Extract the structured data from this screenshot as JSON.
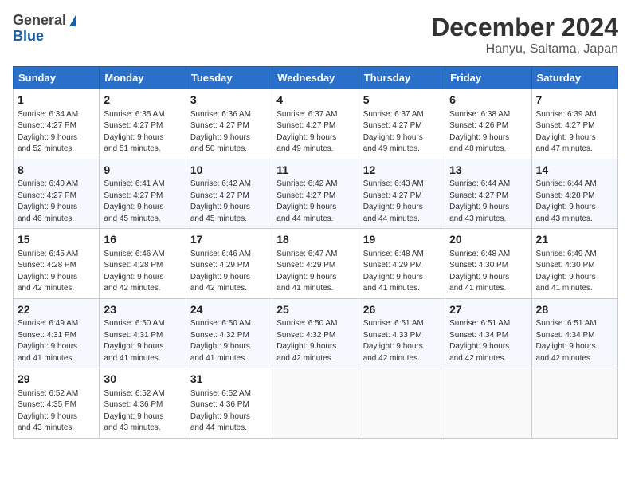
{
  "header": {
    "logo_general": "General",
    "logo_blue": "Blue",
    "title": "December 2024",
    "subtitle": "Hanyu, Saitama, Japan"
  },
  "columns": [
    "Sunday",
    "Monday",
    "Tuesday",
    "Wednesday",
    "Thursday",
    "Friday",
    "Saturday"
  ],
  "weeks": [
    [
      {
        "day": "1",
        "lines": [
          "Sunrise: 6:34 AM",
          "Sunset: 4:27 PM",
          "Daylight: 9 hours",
          "and 52 minutes."
        ]
      },
      {
        "day": "2",
        "lines": [
          "Sunrise: 6:35 AM",
          "Sunset: 4:27 PM",
          "Daylight: 9 hours",
          "and 51 minutes."
        ]
      },
      {
        "day": "3",
        "lines": [
          "Sunrise: 6:36 AM",
          "Sunset: 4:27 PM",
          "Daylight: 9 hours",
          "and 50 minutes."
        ]
      },
      {
        "day": "4",
        "lines": [
          "Sunrise: 6:37 AM",
          "Sunset: 4:27 PM",
          "Daylight: 9 hours",
          "and 49 minutes."
        ]
      },
      {
        "day": "5",
        "lines": [
          "Sunrise: 6:37 AM",
          "Sunset: 4:27 PM",
          "Daylight: 9 hours",
          "and 49 minutes."
        ]
      },
      {
        "day": "6",
        "lines": [
          "Sunrise: 6:38 AM",
          "Sunset: 4:26 PM",
          "Daylight: 9 hours",
          "and 48 minutes."
        ]
      },
      {
        "day": "7",
        "lines": [
          "Sunrise: 6:39 AM",
          "Sunset: 4:27 PM",
          "Daylight: 9 hours",
          "and 47 minutes."
        ]
      }
    ],
    [
      {
        "day": "8",
        "lines": [
          "Sunrise: 6:40 AM",
          "Sunset: 4:27 PM",
          "Daylight: 9 hours",
          "and 46 minutes."
        ]
      },
      {
        "day": "9",
        "lines": [
          "Sunrise: 6:41 AM",
          "Sunset: 4:27 PM",
          "Daylight: 9 hours",
          "and 45 minutes."
        ]
      },
      {
        "day": "10",
        "lines": [
          "Sunrise: 6:42 AM",
          "Sunset: 4:27 PM",
          "Daylight: 9 hours",
          "and 45 minutes."
        ]
      },
      {
        "day": "11",
        "lines": [
          "Sunrise: 6:42 AM",
          "Sunset: 4:27 PM",
          "Daylight: 9 hours",
          "and 44 minutes."
        ]
      },
      {
        "day": "12",
        "lines": [
          "Sunrise: 6:43 AM",
          "Sunset: 4:27 PM",
          "Daylight: 9 hours",
          "and 44 minutes."
        ]
      },
      {
        "day": "13",
        "lines": [
          "Sunrise: 6:44 AM",
          "Sunset: 4:27 PM",
          "Daylight: 9 hours",
          "and 43 minutes."
        ]
      },
      {
        "day": "14",
        "lines": [
          "Sunrise: 6:44 AM",
          "Sunset: 4:28 PM",
          "Daylight: 9 hours",
          "and 43 minutes."
        ]
      }
    ],
    [
      {
        "day": "15",
        "lines": [
          "Sunrise: 6:45 AM",
          "Sunset: 4:28 PM",
          "Daylight: 9 hours",
          "and 42 minutes."
        ]
      },
      {
        "day": "16",
        "lines": [
          "Sunrise: 6:46 AM",
          "Sunset: 4:28 PM",
          "Daylight: 9 hours",
          "and 42 minutes."
        ]
      },
      {
        "day": "17",
        "lines": [
          "Sunrise: 6:46 AM",
          "Sunset: 4:29 PM",
          "Daylight: 9 hours",
          "and 42 minutes."
        ]
      },
      {
        "day": "18",
        "lines": [
          "Sunrise: 6:47 AM",
          "Sunset: 4:29 PM",
          "Daylight: 9 hours",
          "and 41 minutes."
        ]
      },
      {
        "day": "19",
        "lines": [
          "Sunrise: 6:48 AM",
          "Sunset: 4:29 PM",
          "Daylight: 9 hours",
          "and 41 minutes."
        ]
      },
      {
        "day": "20",
        "lines": [
          "Sunrise: 6:48 AM",
          "Sunset: 4:30 PM",
          "Daylight: 9 hours",
          "and 41 minutes."
        ]
      },
      {
        "day": "21",
        "lines": [
          "Sunrise: 6:49 AM",
          "Sunset: 4:30 PM",
          "Daylight: 9 hours",
          "and 41 minutes."
        ]
      }
    ],
    [
      {
        "day": "22",
        "lines": [
          "Sunrise: 6:49 AM",
          "Sunset: 4:31 PM",
          "Daylight: 9 hours",
          "and 41 minutes."
        ]
      },
      {
        "day": "23",
        "lines": [
          "Sunrise: 6:50 AM",
          "Sunset: 4:31 PM",
          "Daylight: 9 hours",
          "and 41 minutes."
        ]
      },
      {
        "day": "24",
        "lines": [
          "Sunrise: 6:50 AM",
          "Sunset: 4:32 PM",
          "Daylight: 9 hours",
          "and 41 minutes."
        ]
      },
      {
        "day": "25",
        "lines": [
          "Sunrise: 6:50 AM",
          "Sunset: 4:32 PM",
          "Daylight: 9 hours",
          "and 42 minutes."
        ]
      },
      {
        "day": "26",
        "lines": [
          "Sunrise: 6:51 AM",
          "Sunset: 4:33 PM",
          "Daylight: 9 hours",
          "and 42 minutes."
        ]
      },
      {
        "day": "27",
        "lines": [
          "Sunrise: 6:51 AM",
          "Sunset: 4:34 PM",
          "Daylight: 9 hours",
          "and 42 minutes."
        ]
      },
      {
        "day": "28",
        "lines": [
          "Sunrise: 6:51 AM",
          "Sunset: 4:34 PM",
          "Daylight: 9 hours",
          "and 42 minutes."
        ]
      }
    ],
    [
      {
        "day": "29",
        "lines": [
          "Sunrise: 6:52 AM",
          "Sunset: 4:35 PM",
          "Daylight: 9 hours",
          "and 43 minutes."
        ]
      },
      {
        "day": "30",
        "lines": [
          "Sunrise: 6:52 AM",
          "Sunset: 4:36 PM",
          "Daylight: 9 hours",
          "and 43 minutes."
        ]
      },
      {
        "day": "31",
        "lines": [
          "Sunrise: 6:52 AM",
          "Sunset: 4:36 PM",
          "Daylight: 9 hours",
          "and 44 minutes."
        ]
      },
      null,
      null,
      null,
      null
    ]
  ]
}
